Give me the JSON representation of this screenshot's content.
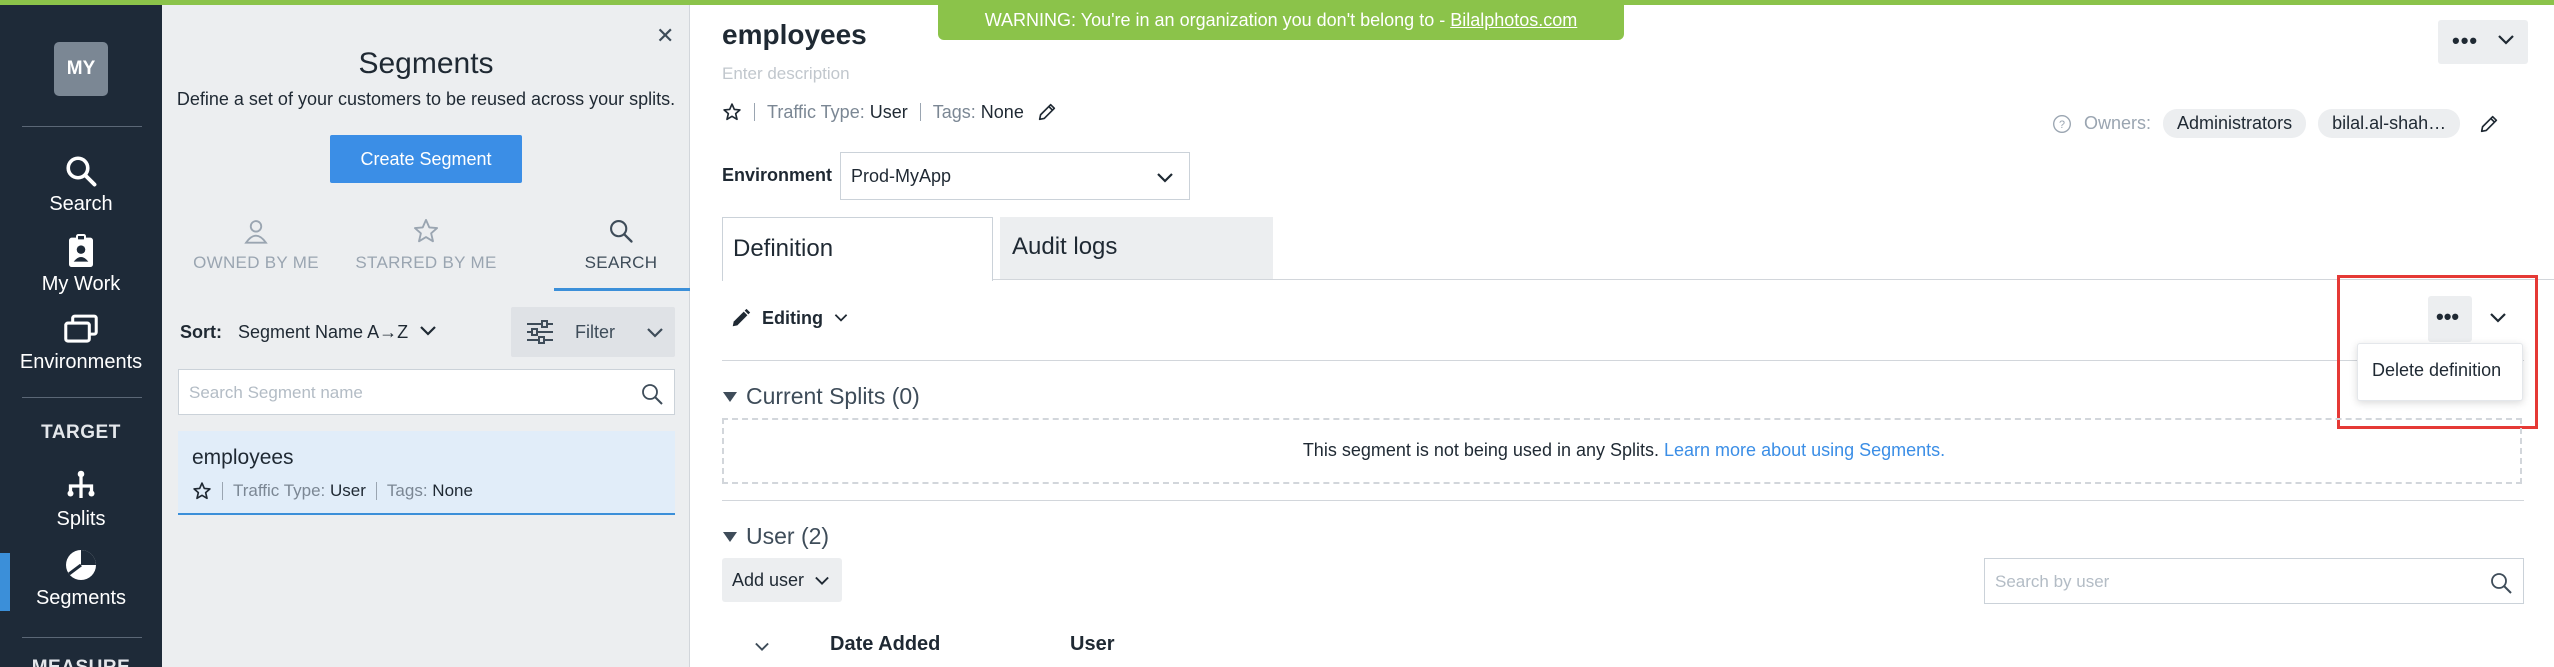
{
  "colors": {
    "accent": "#3b8ee6",
    "warning_bg": "#8bc34a",
    "nav_bg": "#1e2a38",
    "highlight_border": "#e53935"
  },
  "warning": {
    "text": "WARNING: You're in an organization you don't belong to - ",
    "org_link": "Bilalphotos.com"
  },
  "leftnav": {
    "avatar": "MY",
    "items": [
      {
        "label": "Search",
        "icon": "search-icon"
      },
      {
        "label": "My Work",
        "icon": "badge-icon"
      },
      {
        "label": "Environments",
        "icon": "windows-icon"
      }
    ],
    "section_target": "TARGET",
    "target_items": [
      {
        "label": "Splits",
        "icon": "split-icon"
      },
      {
        "label": "Segments",
        "icon": "pie-icon"
      }
    ],
    "section_measure": "MEASURE"
  },
  "segments_panel": {
    "title": "Segments",
    "subtitle": "Define a set of your customers to be reused across your splits.",
    "create_button": "Create Segment",
    "tabs": [
      {
        "label": "OWNED BY ME",
        "icon": "user-icon"
      },
      {
        "label": "STARRED BY ME",
        "icon": "star-icon"
      },
      {
        "label": "SEARCH",
        "icon": "search-icon"
      }
    ],
    "sort_label": "Sort:",
    "sort_value": "Segment Name A→Z",
    "filter_label": "Filter",
    "search_placeholder": "Search Segment name",
    "items": [
      {
        "name": "employees",
        "traffic_type_label": "Traffic Type:",
        "traffic_type": "User",
        "tags_label": "Tags:",
        "tags": "None"
      }
    ]
  },
  "main": {
    "title": "employees",
    "description_placeholder": "Enter description",
    "traffic_type_label": "Traffic Type:",
    "traffic_type": "User",
    "tags_label": "Tags:",
    "tags": "None",
    "owners_label": "Owners:",
    "owners": [
      "Administrators",
      "bilal.al-shah…"
    ],
    "environment_label": "Environment",
    "environment_value": "Prod-MyApp",
    "tabs": [
      "Definition",
      "Audit logs"
    ],
    "editing_label": "Editing",
    "menu_items": [
      "Delete definition"
    ],
    "current_splits_header": "Current Splits (0)",
    "empty_splits_text": "This segment is not being used in any Splits. ",
    "empty_splits_link": "Learn more about using Segments.",
    "user_header": "User (2)",
    "add_user_label": "Add user",
    "user_search_placeholder": "Search by user",
    "columns": [
      "Date Added",
      "User"
    ]
  }
}
